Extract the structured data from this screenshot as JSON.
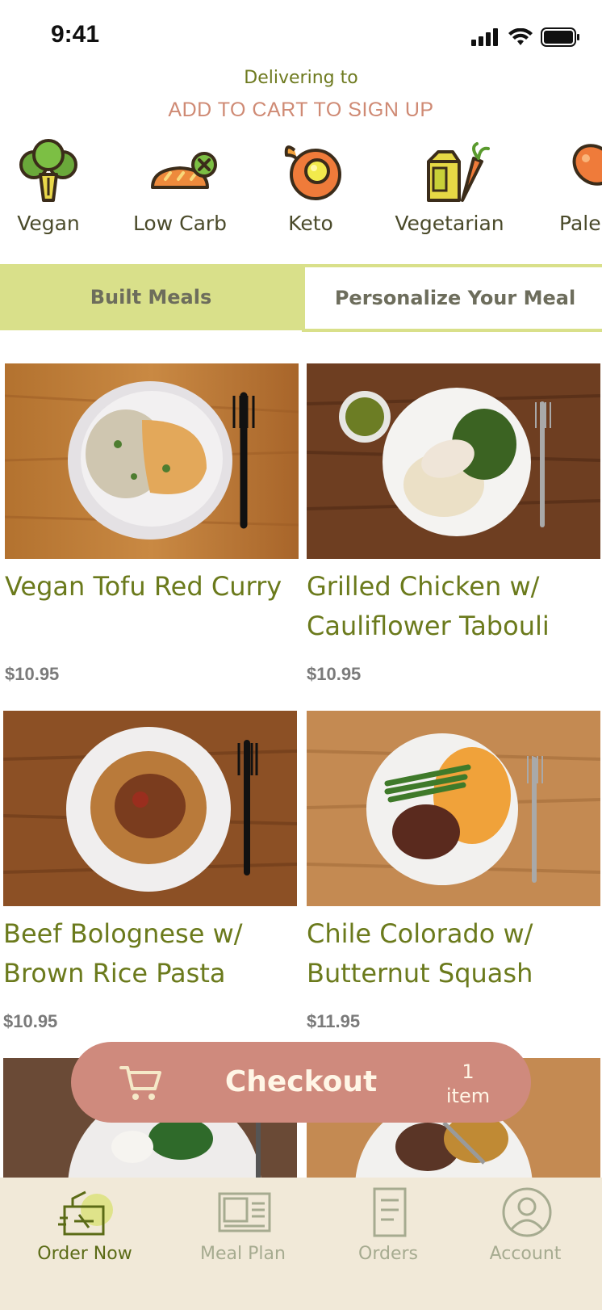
{
  "status": {
    "time": "9:41"
  },
  "header": {
    "delivering_to": "Delivering to",
    "signup_prompt": "ADD TO CART TO SIGN UP"
  },
  "categories": [
    {
      "label": "Vegan",
      "icon": "broccoli-icon"
    },
    {
      "label": "Low Carb",
      "icon": "bread-crossed-icon"
    },
    {
      "label": "Keto",
      "icon": "egg-icon"
    },
    {
      "label": "Vegetarian",
      "icon": "milk-carrot-icon"
    },
    {
      "label": "Paleo",
      "icon": "drumstick-icon"
    }
  ],
  "tabs": {
    "built": "Built Meals",
    "personalize": "Personalize Your Meal"
  },
  "meals": [
    {
      "name": "Vegan Tofu Red Curry",
      "price": "$10.95"
    },
    {
      "name": "Grilled Chicken w/ Cauliflower Tabouli",
      "price": "$10.95"
    },
    {
      "name": "Beef Bolognese w/ Brown Rice Pasta",
      "price": "$10.95"
    },
    {
      "name": "Chile Colorado w/ Butternut Squash",
      "price": "$11.95"
    }
  ],
  "checkout": {
    "label": "Checkout",
    "count": "1",
    "unit": "item"
  },
  "tabbar": [
    {
      "label": "Order Now",
      "icon": "order-bag-icon",
      "active": true
    },
    {
      "label": "Meal Plan",
      "icon": "meal-plan-icon",
      "active": false
    },
    {
      "label": "Orders",
      "icon": "receipt-icon",
      "active": false
    },
    {
      "label": "Account",
      "icon": "account-icon",
      "active": false
    }
  ],
  "colors": {
    "accent_green": "#d9e08a",
    "title_green": "#6b7a1c",
    "checkout": "#cf8a7d",
    "tabbar_bg": "#f1e9d8"
  }
}
